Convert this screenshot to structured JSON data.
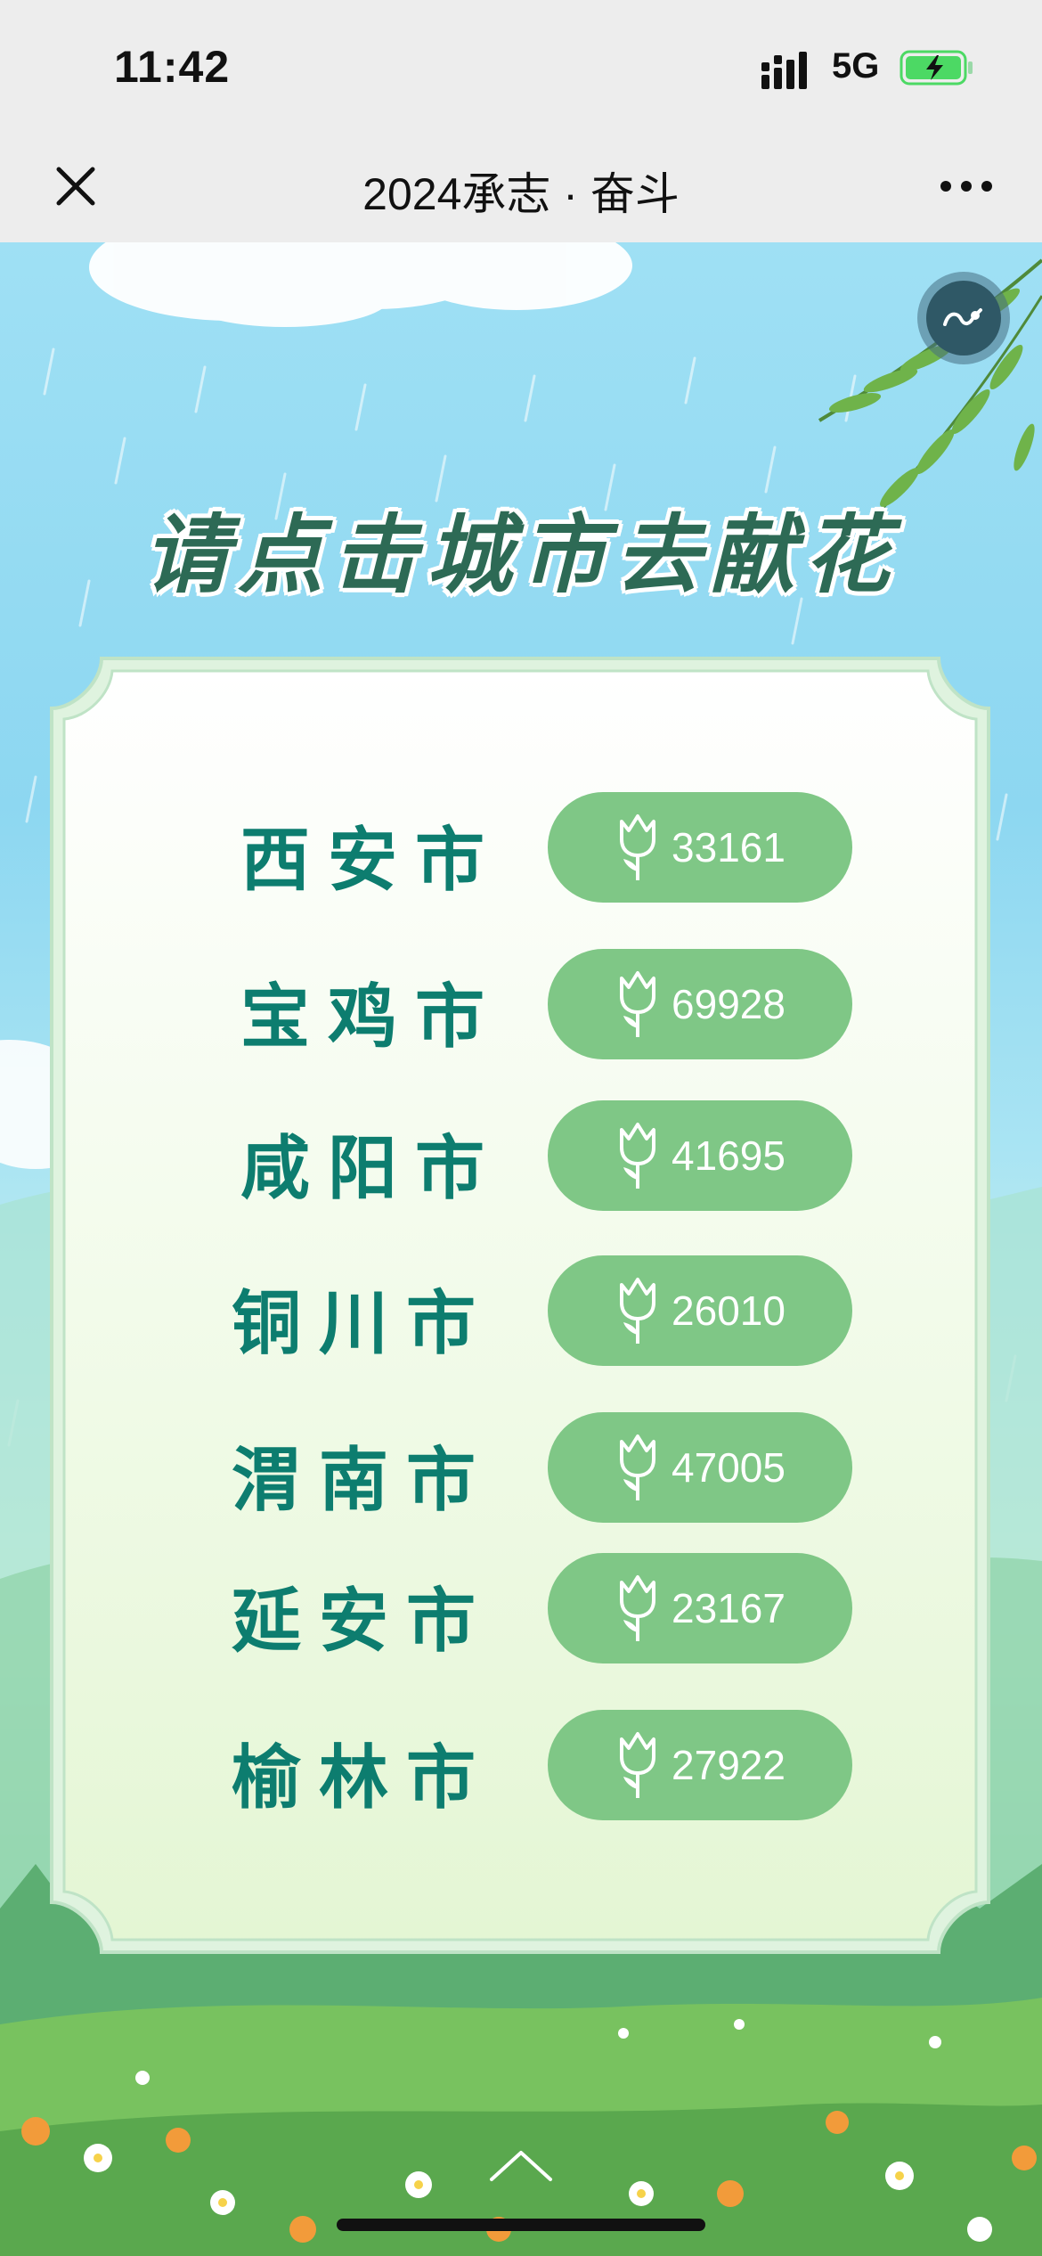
{
  "status_bar": {
    "time": "11:42",
    "network": "5G",
    "battery_color": "#4cd964"
  },
  "nav": {
    "title": "2024承志 · 奋斗",
    "close_icon": "close-icon",
    "more_icon": "more-dots-icon"
  },
  "page": {
    "headline": "请点击城市去献花",
    "music_icon": "music-icon",
    "scroll_icon": "chevron-up-icon"
  },
  "theme": {
    "city_text_color": "#0d7d6f",
    "button_color": "#7fc786",
    "headline_color": "#2d6a55"
  },
  "cities": [
    {
      "name": "西安市",
      "count": "33161"
    },
    {
      "name": "宝鸡市",
      "count": "69928"
    },
    {
      "name": "咸阳市",
      "count": "41695"
    },
    {
      "name": "铜川市",
      "count": "26010"
    },
    {
      "name": "渭南市",
      "count": "47005"
    },
    {
      "name": "延安市",
      "count": "23167"
    },
    {
      "name": "榆林市",
      "count": "27922"
    }
  ]
}
